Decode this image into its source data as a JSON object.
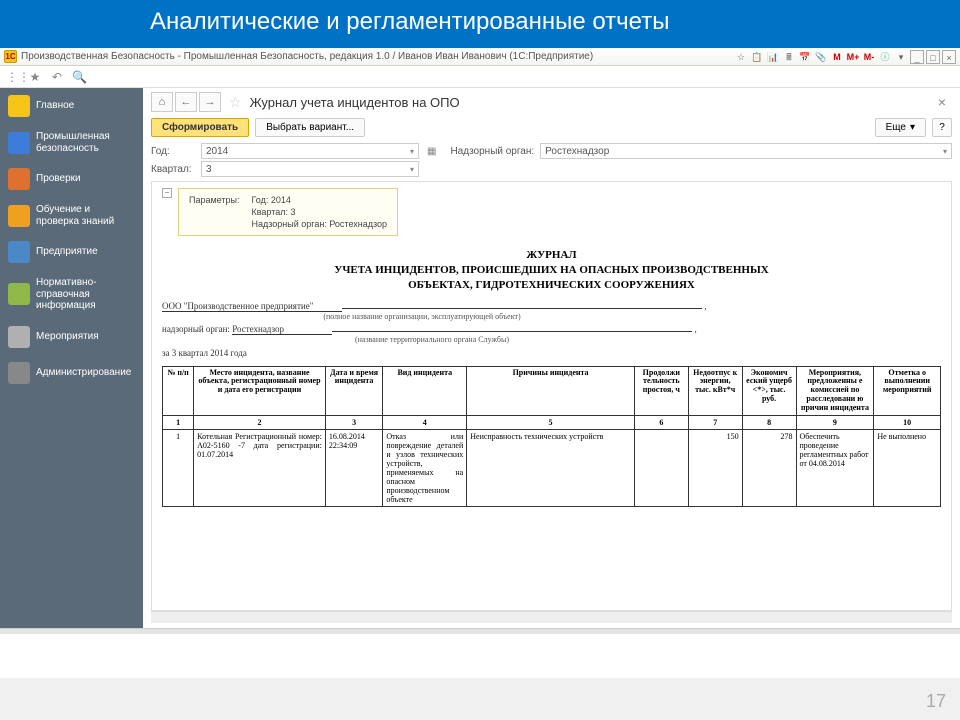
{
  "slide": {
    "title": "Аналитические и регламентированные отчеты",
    "page_number": "17"
  },
  "titlebar": {
    "logo": "1C",
    "text": "Производственная Безопасность - Промышленная Безопасность, редакция 1.0 / Иванов Иван Иванович  (1С:Предприятие)",
    "tb_icons": [
      "☆",
      "📋",
      "📊",
      "🖩",
      "📅",
      "📎",
      "M",
      "M+",
      "M-",
      "ⓘ",
      "▾",
      "_",
      "□",
      "×"
    ]
  },
  "toolbar2": {
    "icons": [
      "⋮⋮",
      "★",
      "↶",
      "🔍"
    ]
  },
  "sidebar": {
    "items": [
      {
        "label": "Главное",
        "color": "#f5c518"
      },
      {
        "label": "Промышленная безопасность",
        "color": "#3b7dd8"
      },
      {
        "label": "Проверки",
        "color": "#e07030"
      },
      {
        "label": "Обучение и проверка знаний",
        "color": "#f0a020"
      },
      {
        "label": "Предприятие",
        "color": "#4a88c8"
      },
      {
        "label": "Нормативно-справочная информация",
        "color": "#8fb84a"
      },
      {
        "label": "Мероприятия",
        "color": "#b0b0b0"
      },
      {
        "label": "Администрирование",
        "color": "#888"
      }
    ]
  },
  "page": {
    "title": "Журнал учета инцидентов на ОПО",
    "btn_generate": "Сформировать",
    "btn_variant": "Выбрать вариант...",
    "btn_more": "Еще",
    "btn_help": "?"
  },
  "filters": {
    "year_label": "Год:",
    "year": "2014",
    "authority_label": "Надзорный орган:",
    "authority": "Ростехнадзор",
    "quarter_label": "Квартал:",
    "quarter": "3"
  },
  "param_box": {
    "head": "Параметры:",
    "line1": "Год: 2014",
    "line2": "Квартал: 3",
    "line3": "Надзорный орган: Ростехнадзор"
  },
  "report": {
    "title1": "ЖУРНАЛ",
    "title2": "УЧЕТА ИНЦИДЕНТОВ, ПРОИСШЕДШИХ НА ОПАСНЫХ ПРОИЗВОДСТВЕННЫХ",
    "title3": "ОБЪЕКТАХ, ГИДРОТЕХНИЧЕСКИХ СООРУЖЕНИЯХ",
    "org": "ООО \"Производственное предприятие\"",
    "org_sub": "(полное название организации, эксплуатирующей объект)",
    "auth_label": "надзорный орган:",
    "auth": "Ростехнадзор",
    "auth_sub": "(название территориального органа Службы)",
    "period": "за 3 квартал 2014 года",
    "headers": [
      "№ п/п",
      "Место инцидента, название объекта, регистрационный номер и дата его регистрации",
      "Дата и время инцидента",
      "Вид инцидента",
      "Причины инцидента",
      "Продолжи тельность простоя, ч",
      "Недоотпус к энергии, тыс. кВт*ч",
      "Экономич еский ущерб <*>, тыс. руб.",
      "Мероприятия, предложенны е комиссией по расследовани ю причин инцидента",
      "Отметка о выполнении мероприятий"
    ],
    "nums": [
      "1",
      "2",
      "3",
      "4",
      "5",
      "6",
      "7",
      "8",
      "9",
      "10"
    ],
    "row": {
      "c1": "1",
      "c2": "Котельная Регистрационный номер: А02-5160 -7 дата регистрации: 01.07.2014",
      "c3": "16.08.2014 22:34:09",
      "c4": "Отказ или повреждение деталей и узлов технических устройств, применяемых на опасном производственном объекте",
      "c5": "Неисправность технических устройств",
      "c6": "",
      "c7": "150",
      "c8": "278",
      "c9": "Обеспечить проведение регламентных работ от 04.08.2014",
      "c10": "Не выполнено"
    }
  }
}
